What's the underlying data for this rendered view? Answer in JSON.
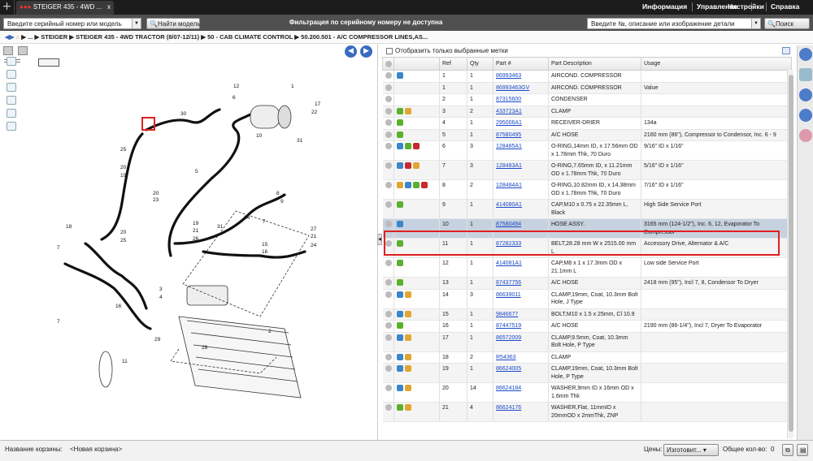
{
  "header": {
    "tab_title": "STEIGER 435 - 4WD ...",
    "plus": "+",
    "close": "x",
    "menu": [
      "Информация",
      "Управление",
      "Настройки",
      "Справка"
    ]
  },
  "toolbar": {
    "serial_placeholder": "Введите серийный номер или модель",
    "find_model": "Найти модель",
    "filter_msg": "Фильтрация по серийному номеру не доступна",
    "search_placeholder": "Введите №, описание или изображение детали",
    "search_btn": "Поиск"
  },
  "breadcrumb": "▶ ... ▶ STEIGER ▶ STEIGER 435 - 4WD TRACTOR (8/07-12/11) ▶ 50 - CAB CLIMATE CONTROL ▶ 50.200.501 - A/C COMPRESSOR LINES,AS...",
  "parts": {
    "show_selected": "Отобразить только выбранные метки",
    "columns": [
      "Ref",
      "Qty",
      "Part #",
      "Part Description",
      "Usage"
    ],
    "rows": [
      {
        "ref": "1",
        "qty": "1",
        "part": "86993463",
        "desc": "AIRCOND. COMPRESSOR",
        "usage": ""
      },
      {
        "ref": "1",
        "qty": "1",
        "part": "86993463GV",
        "desc": "AIRCOND. COMPRESSOR",
        "usage": "Value"
      },
      {
        "ref": "2",
        "qty": "1",
        "part": "87315600",
        "desc": "CONDENSER",
        "usage": ""
      },
      {
        "ref": "3",
        "qty": "2",
        "part": "433723A1",
        "desc": "CLAMP",
        "usage": ""
      },
      {
        "ref": "4",
        "qty": "1",
        "part": "295006A1",
        "desc": "RECEIVER-DRIER",
        "usage": "134a"
      },
      {
        "ref": "5",
        "qty": "1",
        "part": "87580495",
        "desc": "A/C HOSE",
        "usage": "2160 mm (86\"), Compressor to Condensor, Inc. 6 - 9"
      },
      {
        "ref": "6",
        "qty": "3",
        "part": "128485A1",
        "desc": "O-RING,14mm ID, x 17.56mm OD x 1.78mm Thk, 70 Duro",
        "usage": "9/16\" ID x 1/16\""
      },
      {
        "ref": "7",
        "qty": "3",
        "part": "128483A1",
        "desc": "O-RING,7.65mm ID, x 11.21mm OD x 1.78mm Thk, 70 Duro",
        "usage": "5/16\" ID x 1/16\""
      },
      {
        "ref": "8",
        "qty": "2",
        "part": "128484A1",
        "desc": "O-RING,10.82mm ID, x 14.38mm OD x 1.78mm Thk, 70 Duro",
        "usage": "7/16\" ID x 1/16\""
      },
      {
        "ref": "9",
        "qty": "1",
        "part": "414080A1",
        "desc": "CAP,M10 x 0.75 x 22.35mm L, Black",
        "usage": "High Side Service Port"
      },
      {
        "ref": "10",
        "qty": "1",
        "part": "87580494",
        "desc": "HOSE ASSY.",
        "usage": "3165 mm (124-1/2\"), Inc. 6, 12, Evaporator To Compressor"
      },
      {
        "ref": "11",
        "qty": "1",
        "part": "87282333",
        "desc": "BELT,28.28 mm W x 2515.00 mm L",
        "usage": "Accessory Drive, Alternator & A/C"
      },
      {
        "ref": "12",
        "qty": "1",
        "part": "414081A1",
        "desc": "CAP,M8 x 1 x 17.3mm OD x 21.1mm L",
        "usage": "Low side Service Port"
      },
      {
        "ref": "13",
        "qty": "1",
        "part": "87437756",
        "desc": "A/C HOSE",
        "usage": "2418 mm (95\"), Incl 7, 8, Condensor To Dryer"
      },
      {
        "ref": "14",
        "qty": "3",
        "part": "86639011",
        "desc": "CLAMP,19mm, Coat, 10.3mm Bolt Hole, J Type",
        "usage": ""
      },
      {
        "ref": "15",
        "qty": "1",
        "part": "9846677",
        "desc": "BOLT,M10 x 1.5 x 25mm, Cl 10.9",
        "usage": ""
      },
      {
        "ref": "16",
        "qty": "1",
        "part": "87447519",
        "desc": "A/C HOSE",
        "usage": "2190 mm (86-1/4\"), Incl 7, Dryer To Evaporator"
      },
      {
        "ref": "17",
        "qty": "1",
        "part": "86572009",
        "desc": "CLAMP,9.5mm, Coat, 10.3mm Bolt Hole, P Type",
        "usage": ""
      },
      {
        "ref": "18",
        "qty": "2",
        "part": "R54363",
        "desc": "CLAMP",
        "usage": ""
      },
      {
        "ref": "19",
        "qty": "1",
        "part": "86624005",
        "desc": "CLAMP,19mm, Coat, 10.3mm Bolt Hole, P Type",
        "usage": ""
      },
      {
        "ref": "20",
        "qty": "14",
        "part": "86624184",
        "desc": "WASHER,9mm ID x 16mm OD x 1.6mm Thk",
        "usage": ""
      },
      {
        "ref": "21",
        "qty": "4",
        "part": "86624176",
        "desc": "WASHER,Flat, 11mmID x 20mmOD x 2mmThk, ZNP",
        "usage": ""
      }
    ]
  },
  "footer": {
    "cart_label": "Название корзины:",
    "cart_name": "<Новая корзина>",
    "prices_label": "Цены:",
    "prices_value": "Изготовит...",
    "total_label": "Общее кол-во:",
    "total_value": "0"
  },
  "diagram": {
    "callouts": [
      "1",
      "2",
      "3",
      "4",
      "5",
      "6",
      "7",
      "8",
      "9",
      "10",
      "11",
      "12",
      "13",
      "14",
      "15",
      "16",
      "17",
      "18",
      "19",
      "20",
      "21",
      "22",
      "23",
      "24",
      "25",
      "26",
      "27",
      "28",
      "29",
      "30",
      "31"
    ]
  }
}
